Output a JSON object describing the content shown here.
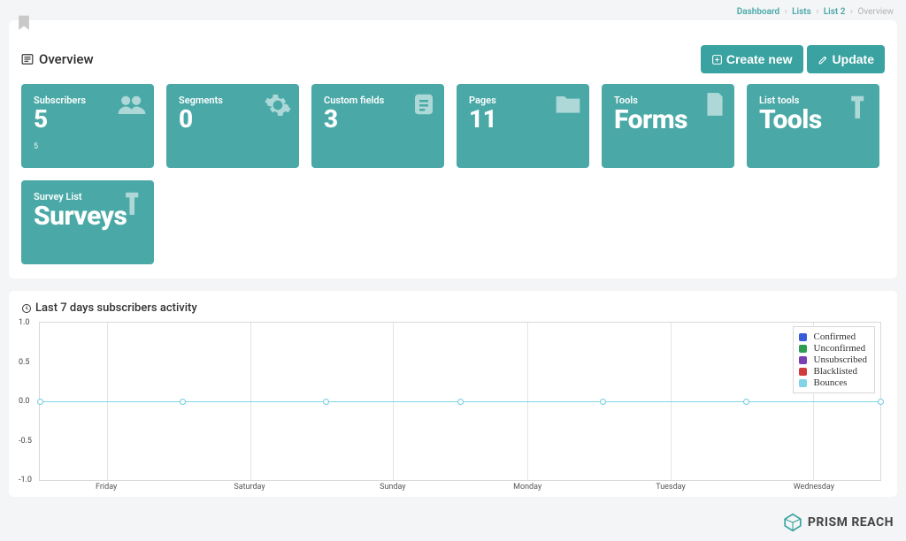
{
  "breadcrumb": {
    "dashboard": "Dashboard",
    "lists": "Lists",
    "list2": "List 2",
    "current": "Overview"
  },
  "overview": {
    "title": "Overview",
    "buttons": {
      "create": "Create new",
      "update": "Update"
    },
    "cards": [
      {
        "label": "Subscribers",
        "value": "5",
        "sub": "5"
      },
      {
        "label": "Segments",
        "value": "0"
      },
      {
        "label": "Custom fields",
        "value": "3"
      },
      {
        "label": "Pages",
        "value": "11"
      },
      {
        "label": "Tools",
        "value": "Forms"
      },
      {
        "label": "List tools",
        "value": "Tools"
      },
      {
        "label": "Survey List",
        "value": "Surveys"
      }
    ]
  },
  "activity": {
    "title": "Last 7 days subscribers activity",
    "legend": {
      "confirmed": "Confirmed",
      "unconfirmed": "Unconfirmed",
      "unsubscribed": "Unsubscribed",
      "blacklisted": "Blacklisted",
      "bounces": "Bounces"
    },
    "y_ticks": [
      "1.0",
      "0.5",
      "0.0",
      "-0.5",
      "-1.0"
    ],
    "x_labels": [
      "Friday",
      "Saturday",
      "Sunday",
      "Monday",
      "Tuesday",
      "Wednesday"
    ]
  },
  "chart_data": {
    "type": "line",
    "title": "Last 7 days subscribers activity",
    "xlabel": "",
    "ylabel": "",
    "ylim": [
      -1.0,
      1.0
    ],
    "categories": [
      "Friday",
      "Saturday",
      "Sunday",
      "Monday",
      "Tuesday",
      "Wednesday"
    ],
    "series": [
      {
        "name": "Confirmed",
        "color": "#3a5bd9",
        "values": [
          0,
          0,
          0,
          0,
          0,
          0
        ]
      },
      {
        "name": "Unconfirmed",
        "color": "#2e9e4e",
        "values": [
          0,
          0,
          0,
          0,
          0,
          0
        ]
      },
      {
        "name": "Unsubscribed",
        "color": "#7a3fb3",
        "values": [
          0,
          0,
          0,
          0,
          0,
          0
        ]
      },
      {
        "name": "Blacklisted",
        "color": "#d23b3b",
        "values": [
          0,
          0,
          0,
          0,
          0,
          0
        ]
      },
      {
        "name": "Bounces",
        "color": "#7fd5e6",
        "values": [
          0,
          0,
          0,
          0,
          0,
          0
        ]
      }
    ],
    "legend_position": "top-right",
    "grid": true
  },
  "brand": "PRISM REACH"
}
